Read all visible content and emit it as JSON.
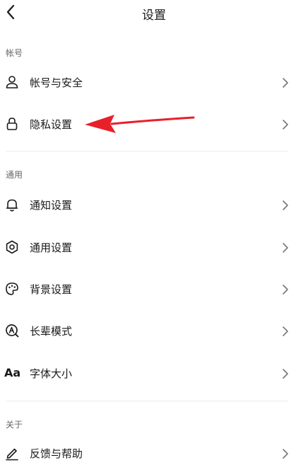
{
  "header": {
    "title": "设置",
    "back_icon": "chevron-left-icon"
  },
  "sections": [
    {
      "label": "帐号",
      "items": [
        {
          "label": "帐号与安全",
          "icon": "person-icon"
        },
        {
          "label": "隐私设置",
          "icon": "lock-icon"
        }
      ]
    },
    {
      "label": "通用",
      "items": [
        {
          "label": "通知设置",
          "icon": "bell-icon"
        },
        {
          "label": "通用设置",
          "icon": "gear-icon"
        },
        {
          "label": "背景设置",
          "icon": "palette-icon"
        },
        {
          "label": "长辈模式",
          "icon": "elder-mode-icon"
        },
        {
          "label": "字体大小",
          "icon": "font-size-icon",
          "icon_text": "Aa"
        }
      ]
    },
    {
      "label": "关于",
      "items": [
        {
          "label": "反馈与帮助",
          "icon": "pencil-icon"
        }
      ]
    }
  ],
  "colors": {
    "annotation_arrow": "#e8202a",
    "divider": "#ececec",
    "section_label": "#666666"
  }
}
